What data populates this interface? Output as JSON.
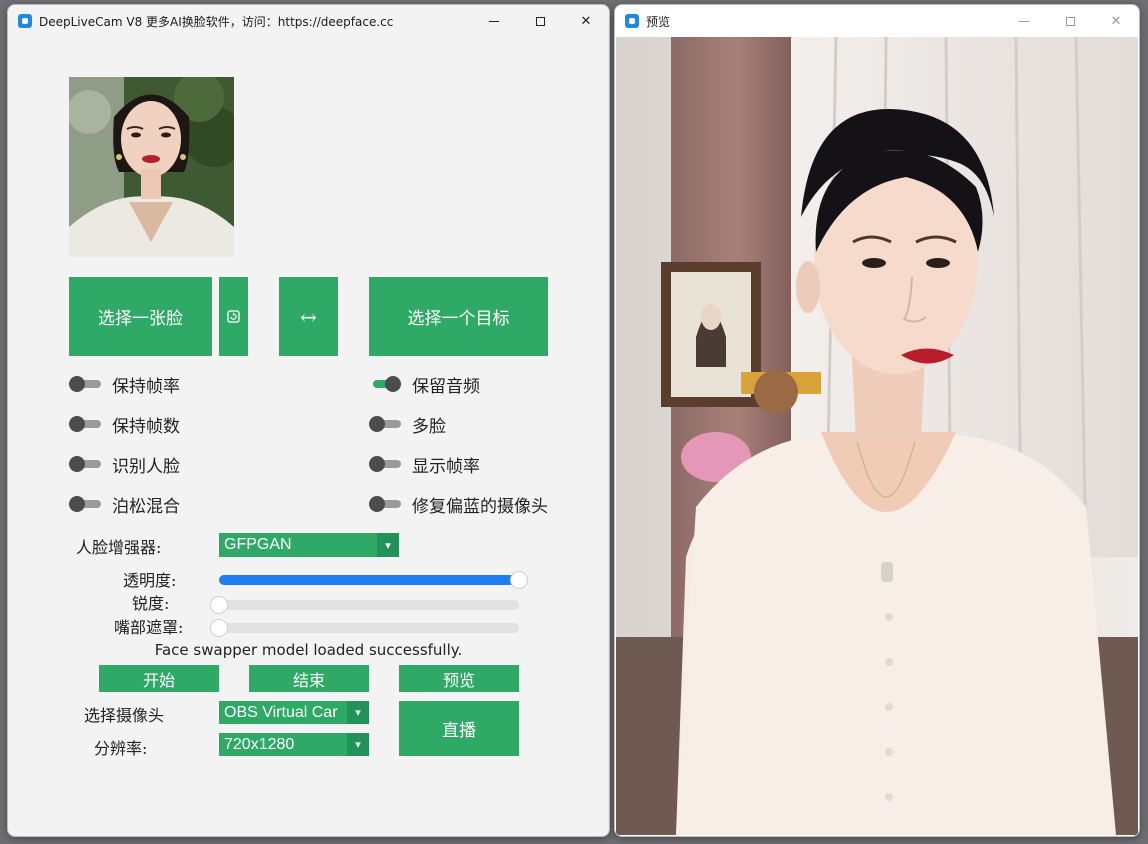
{
  "main_window": {
    "title": "DeepLiveCam V8 更多AI换脸软件，访问：https://deepface.cc",
    "controls": {
      "minimize": "—",
      "maximize": "□",
      "close": "✕"
    }
  },
  "preview_window": {
    "title": "预览",
    "controls": {
      "minimize": "—",
      "maximize": "□",
      "close": "✕"
    }
  },
  "buttons": {
    "select_face": "选择一张脸",
    "swap": "↔",
    "select_target": "选择一个目标",
    "start": "开始",
    "stop": "结束",
    "preview": "预览",
    "live": "直播"
  },
  "toggles_left": [
    {
      "label": "保持帧率",
      "on": false
    },
    {
      "label": "保持帧数",
      "on": false
    },
    {
      "label": "识别人脸",
      "on": false
    },
    {
      "label": "泊松混合",
      "on": false
    }
  ],
  "toggles_right": [
    {
      "label": "保留音频",
      "on": true
    },
    {
      "label": "多脸",
      "on": false
    },
    {
      "label": "显示帧率",
      "on": false
    },
    {
      "label": "修复偏蓝的摄像头",
      "on": false
    }
  ],
  "enhancer": {
    "label": "人脸增强器:",
    "value": "GFPGAN"
  },
  "sliders": [
    {
      "label": "透明度:",
      "value": 1.0
    },
    {
      "label": "锐度:",
      "value": 0.0
    },
    {
      "label": "嘴部遮罩:",
      "value": 0.0
    }
  ],
  "status_message": "Face swapper model loaded successfully.",
  "camera": {
    "label": "选择摄像头",
    "value": "OBS Virtual Car"
  },
  "resolution": {
    "label": "分辨率:",
    "value": "720x1280"
  },
  "colors": {
    "accent_green": "#2eaa66",
    "slider_blue": "#1f7ff0",
    "window_bg": "#f3f3f3"
  }
}
